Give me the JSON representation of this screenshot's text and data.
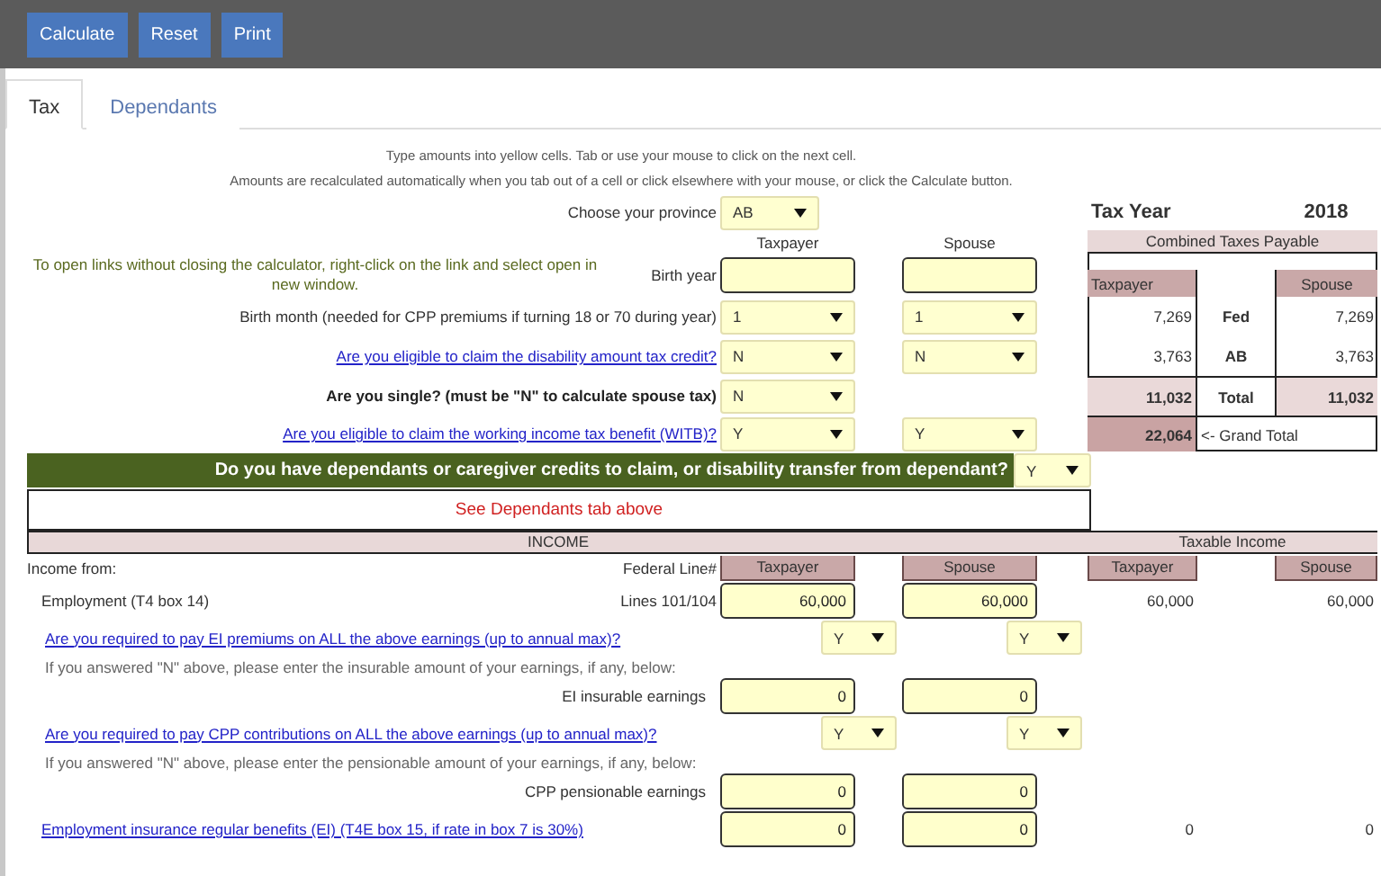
{
  "toolbar": {
    "buttons": [
      "Calculate",
      "Reset",
      "Print"
    ]
  },
  "tabs": [
    {
      "label": "Tax",
      "selected": true
    },
    {
      "label": "Dependants",
      "selected": false
    }
  ],
  "instructions": [
    "Type amounts into yellow cells.  Tab or use your mouse to click on the next cell.",
    "Amounts are recalculated automatically when you tab out of a cell or click elsewhere with your mouse, or click the Calculate button."
  ],
  "province": {
    "label": "Choose your province",
    "value": "AB"
  },
  "column_headers": [
    "Taxpayer",
    "Spouse"
  ],
  "note": "To open links without closing the calculator, right-click on the link and select open in new window.",
  "personal_rows": [
    {
      "kind": "input",
      "label": "Birth year"
    },
    {
      "kind": "select",
      "label": "Birth month (needed for CPP premiums if turning 18 or 70 during year)",
      "taxpayer": "1",
      "spouse": "1"
    },
    {
      "kind": "link",
      "label": "Are you eligible to claim the disability amount tax credit?",
      "taxpayer": "N",
      "spouse": "N"
    },
    {
      "kind": "bold",
      "label": "Are you single? (must be \"N\" to calculate spouse tax)",
      "taxpayer": "N"
    },
    {
      "kind": "link",
      "label": "Are you eligible to claim the working income tax benefit (WITB)?",
      "taxpayer": "Y",
      "spouse": "Y"
    }
  ],
  "tax_summary": {
    "title": "Tax Year",
    "year": "2018",
    "heading": "Combined Taxes Payable",
    "columns": [
      "Taxpayer",
      "Spouse"
    ],
    "rows": [
      {
        "kind": "plain",
        "label": "Fed",
        "taxpayer": "7,269",
        "spouse": "7,269"
      },
      {
        "kind": "plain",
        "label": "AB",
        "taxpayer": "3,763",
        "spouse": "3,763"
      },
      {
        "kind": "total",
        "label": "Total",
        "taxpayer": "11,032",
        "spouse": "11,032"
      }
    ],
    "grand_total": {
      "value": "22,064",
      "label": "<- Grand Total"
    }
  },
  "dependants": {
    "question": "Do you have dependants or caregiver credits to claim, or disability transfer from dependant?",
    "answer": "Y",
    "notice": "See Dependants tab above"
  },
  "income": {
    "heading": "INCOME",
    "taxable_heading": "Taxable Income",
    "from_label": "Income from:",
    "line_label": "Federal Line#",
    "columns": [
      "Taxpayer",
      "Spouse"
    ],
    "taxable_columns": [
      "Taxpayer",
      "Spouse"
    ],
    "rows": [
      {
        "kind": "amount",
        "label": "Employment (T4 box 14)",
        "line": "Lines 101/104",
        "taxpayer": "60,000",
        "spouse": "60,000",
        "taxable_taxpayer": "60,000",
        "taxable_spouse": "60,000"
      },
      {
        "kind": "question",
        "label": "Are you required to pay EI premiums on ALL the above earnings (up to annual max)?",
        "taxpayer": "Y",
        "spouse": "Y"
      },
      {
        "kind": "note",
        "label": "If you answered \"N\" above, please enter the insurable amount of your earnings, if any, below:"
      },
      {
        "kind": "subamount",
        "label": "EI insurable earnings",
        "taxpayer": "0",
        "spouse": "0"
      },
      {
        "kind": "question",
        "label": "Are you required to pay CPP contributions on ALL the above earnings (up to annual max)?",
        "taxpayer": "Y",
        "spouse": "Y"
      },
      {
        "kind": "note",
        "label": "If you answered \"N\" above, please enter the pensionable amount of your earnings, if any, below:"
      },
      {
        "kind": "subamount",
        "label": "CPP pensionable earnings",
        "taxpayer": "0",
        "spouse": "0"
      },
      {
        "kind": "linked",
        "label": "Employment insurance regular benefits (EI) (T4E box 15, if rate in box 7 is 30%)",
        "taxpayer": "0",
        "spouse": "0",
        "taxable_taxpayer": "0",
        "taxable_spouse": "0"
      }
    ]
  }
}
